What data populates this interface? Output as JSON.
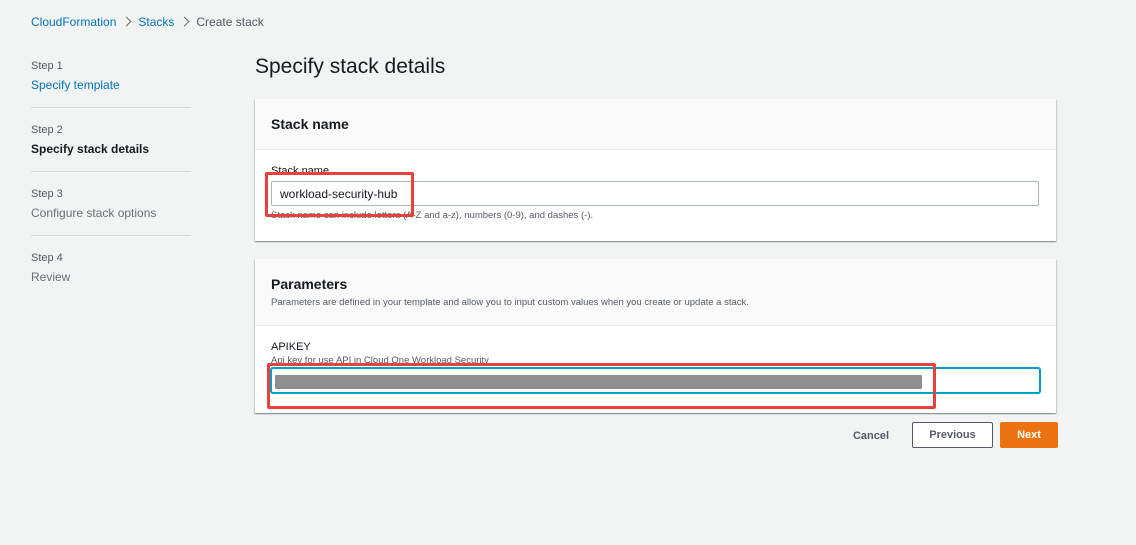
{
  "breadcrumb": {
    "items": [
      "CloudFormation",
      "Stacks"
    ],
    "current": "Create stack"
  },
  "steps": [
    {
      "num": "Step 1",
      "label": "Specify template"
    },
    {
      "num": "Step 2",
      "label": "Specify stack details"
    },
    {
      "num": "Step 3",
      "label": "Configure stack options"
    },
    {
      "num": "Step 4",
      "label": "Review"
    }
  ],
  "page_title": "Specify stack details",
  "stack_name_section": {
    "title": "Stack name",
    "field_label": "Stack name",
    "value": "workload-security-hub",
    "hint": "Stack name can include letters (A-Z and a-z), numbers (0-9), and dashes (-)."
  },
  "parameters_section": {
    "title": "Parameters",
    "description": "Parameters are defined in your template and allow you to input custom values when you create or update a stack.",
    "apikey_label": "APIKEY",
    "apikey_description": "Api key for use API in Cloud One Workload Security"
  },
  "buttons": {
    "cancel": "Cancel",
    "previous": "Previous",
    "next": "Next"
  },
  "colors": {
    "link": "#0073bb",
    "primary_button": "#ec7211",
    "highlight": "#e8413c",
    "focus": "#00a1c9"
  }
}
